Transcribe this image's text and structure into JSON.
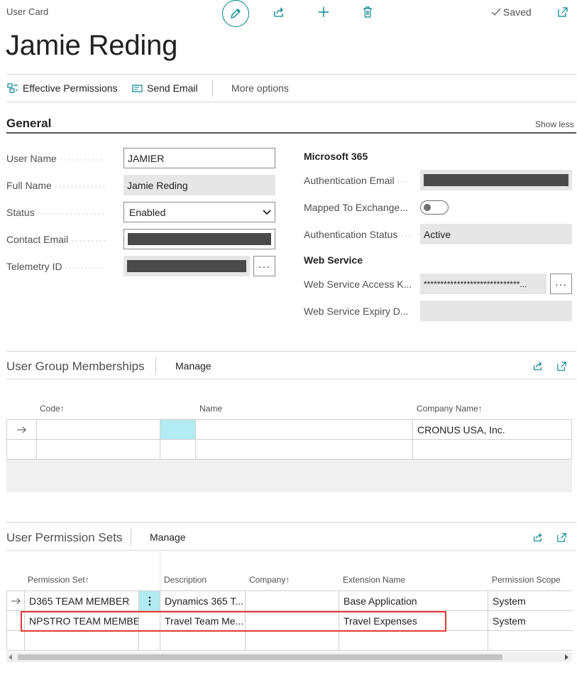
{
  "header": {
    "page_type": "User Card",
    "title": "Jamie Reding",
    "saved_label": "Saved"
  },
  "actions": {
    "effective_permissions": "Effective Permissions",
    "send_email": "Send Email",
    "more_options": "More options"
  },
  "general": {
    "title": "General",
    "show_less": "Show less",
    "user_name_label": "User Name",
    "user_name_value": "JAMIER",
    "full_name_label": "Full Name",
    "full_name_value": "Jamie Reding",
    "status_label": "Status",
    "status_value": "Enabled",
    "contact_email_label": "Contact Email",
    "telemetry_id_label": "Telemetry ID",
    "ms365_heading": "Microsoft 365",
    "auth_email_label": "Authentication Email",
    "mapped_exchange_label": "Mapped To Exchange...",
    "auth_status_label": "Authentication Status",
    "auth_status_value": "Active",
    "web_service_heading": "Web Service",
    "ws_access_key_label": "Web Service Access K...",
    "ws_access_key_value": "*****************************...",
    "ws_expiry_label": "Web Service Expiry D...",
    "ellipsis": "···"
  },
  "group_memberships": {
    "title": "User Group Memberships",
    "manage": "Manage",
    "columns": {
      "code": "Code",
      "name": "Name",
      "company": "Company Name"
    },
    "sort_arrow": "↑",
    "rows": [
      {
        "company": "CRONUS USA, Inc."
      }
    ]
  },
  "permission_sets": {
    "title": "User Permission Sets",
    "manage": "Manage",
    "columns": {
      "permission_set": "Permission Set",
      "description": "Description",
      "company": "Company",
      "extension": "Extension Name",
      "scope": "Permission Scope"
    },
    "sort_arrow": "↑",
    "rows": [
      {
        "permission_set": "D365 TEAM MEMBER",
        "description": "Dynamics 365 T...",
        "company": "",
        "extension": "Base Application",
        "scope": "System"
      },
      {
        "permission_set": "NPSTRO TEAM MEMBER",
        "description": "Travel Team Me...",
        "company": "",
        "extension": "Travel Expenses",
        "scope": "System"
      }
    ]
  },
  "colors": {
    "accent": "#00838f",
    "highlight": "#e53935",
    "selected_cell": "#b2ebf2"
  }
}
